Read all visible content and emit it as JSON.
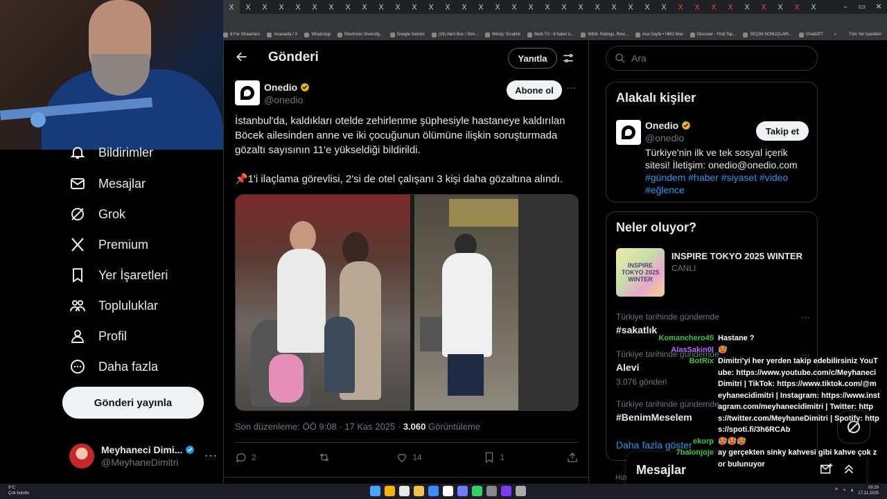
{
  "browser": {
    "tab_glyph": "X",
    "window_controls": [
      "–",
      "▭",
      "✕"
    ],
    "bookmarks": [
      "d For Streamers",
      "Anasayfa / X",
      "WhatsApp",
      "Electronic Diversity...",
      "Google Gemini",
      "(19) Alert Box / Stre...",
      "Windy: Sıcaklık",
      "Multi TV - 6 haber k...",
      "IMDb: Ratings, Revi...",
      "Ana Sayfa • HBO Max",
      "Discover - Find Top...",
      "SEÇİM SONUÇLARI...",
      "ChatGPT"
    ],
    "bookmarks_more": "»",
    "bookmarks_all": "Tüm Yer İşaretleri"
  },
  "sidebar": {
    "items": [
      {
        "label": "Bildirimler",
        "icon": "bell-icon"
      },
      {
        "label": "Mesajlar",
        "icon": "envelope-icon"
      },
      {
        "label": "Grok",
        "icon": "grok-icon"
      },
      {
        "label": "Premium",
        "icon": "x-logo-icon"
      },
      {
        "label": "Yer İşaretleri",
        "icon": "bookmark-icon"
      },
      {
        "label": "Topluluklar",
        "icon": "communities-icon"
      },
      {
        "label": "Profil",
        "icon": "person-icon"
      },
      {
        "label": "Daha fazla",
        "icon": "more-circle-icon"
      }
    ],
    "post_button": "Gönderi yayınla",
    "profile": {
      "display_name": "Meyhaneci Dimi...",
      "handle": "@MeyhaneDimitri",
      "more": "···"
    }
  },
  "main": {
    "title": "Gönderi",
    "reply_button": "Yanıtla",
    "tweet": {
      "author_name": "Onedio",
      "author_handle": "@onedio",
      "follow_button": "Abone ol",
      "more": "···",
      "text": "İstanbul'da, kaldıkları otelde zehirlenme şüphesiyle hastaneye kaldırılan Böcek ailesinden anne ve iki çocuğunun ölümüne ilişkin soruşturmada gözaltı sayısının 11'e yükseldiği bildirildi.\n\n📌1'i ilaçlama görevlisi, 2'si de otel çalışanı 3 kişi daha gözaltına alındı.",
      "meta_prefix": "Son düzenleme: ÖÖ 9:08 · 17 Kas 2025 · ",
      "views": "3.060",
      "views_label": " Görüntüleme",
      "actions": {
        "replies": "2",
        "retweets": "",
        "likes": "14",
        "bookmarks": "1"
      }
    }
  },
  "right": {
    "search_placeholder": "Ara",
    "related": {
      "title": "Alakalı kişiler",
      "name": "Onedio",
      "handle": "@onedio",
      "follow_button": "Takip et",
      "bio": "Türkiye'nin ilk ve tek sosyal içerik sitesi! İletişim: onedio@onedio.com",
      "tags": "#gündem #haber #siyaset #video #eğlence"
    },
    "trends": {
      "title": "Neler oluyor?",
      "event_title": "INSPIRE TOKYO 2025 WINTER",
      "event_status": "CANLI",
      "event_tile": "INSPIRE TOKYO 2025 WINTER",
      "items": [
        {
          "context": "Türkiye tarihinde gündemde",
          "title": "#sakatlık",
          "count": ""
        },
        {
          "context": "Türkiye tarihinde gündemde",
          "title": "Alevi",
          "count": "3.076 gönderi"
        },
        {
          "context": "Türkiye tarihinde gündemde",
          "title": "#BenimMeselem",
          "count": ""
        }
      ],
      "dots": "···",
      "show_more": "Daha fazla göster"
    },
    "messages_title": "Mesajlar",
    "footer_fragment": "Hizm"
  },
  "chat": {
    "messages": [
      {
        "user": "Komanchero45",
        "color": "#2ecc40",
        "text": "Hastane ?"
      },
      {
        "user": "AlasSakin0l",
        "color": "#b36bff",
        "text": "🥵"
      },
      {
        "user": "BotRix",
        "color": "#2ecc40",
        "text": "Dimitri'yi her yerden takip edebilirsiniz YouTube: https://www.youtube.com/c/MeyhaneciDimitri | TikTok: https://www.tiktok.com/@meyhanecidimitri | Instagram: https://www.instagram.com/meyhanecidimitri | Twitter: https://twitter.com/MeyhaneDimitri | Spotify: https://spoti.fi/3h6RCAb"
      },
      {
        "user": "ekorp",
        "color": "#2ecc40",
        "text": "🥵🥵🥵"
      },
      {
        "user": "7balonjoje",
        "color": "#2ecc40",
        "text": "ay gerçekten sinky kahvesi gibi kahve çok zor bulunuyor"
      }
    ]
  },
  "taskbar": {
    "weather_temp": "9°C",
    "weather_desc": "Çok bulutlu",
    "time": "09:29",
    "date": "17.11.2025",
    "icon_colors": [
      "#4aa3ff",
      "#f5b400",
      "#e8e8e8",
      "#f0c24a",
      "#3b8cff",
      "#ffffff",
      "#6c7bff",
      "#2fd26a",
      "#888",
      "#7b3cff",
      "#aaa"
    ]
  }
}
